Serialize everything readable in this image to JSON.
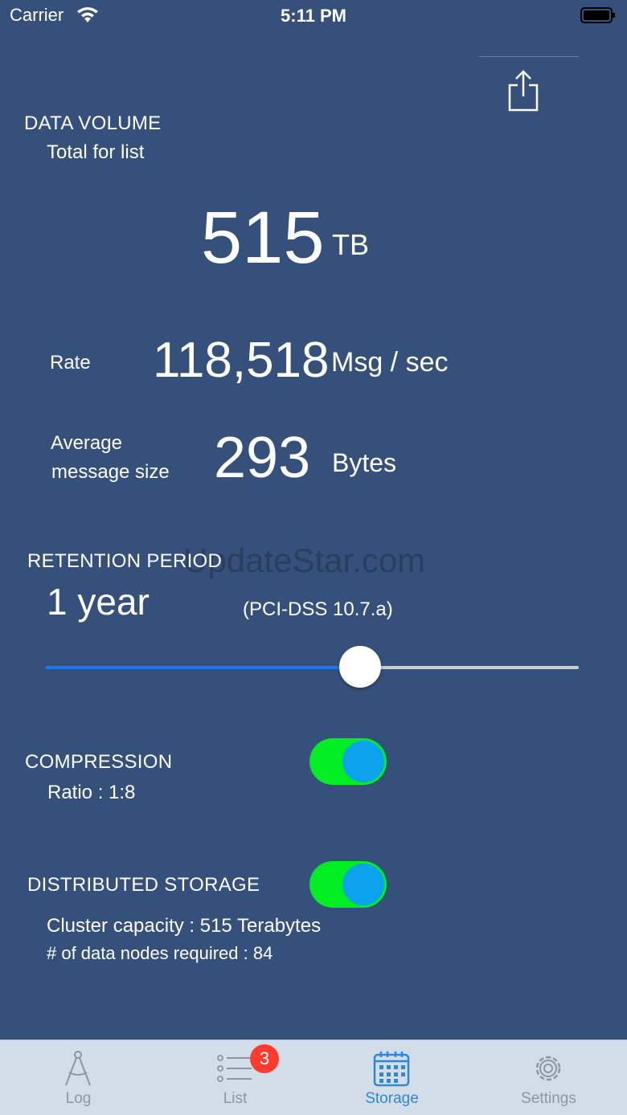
{
  "status_bar": {
    "carrier": "Carrier",
    "time": "5:11 PM"
  },
  "data_volume": {
    "title": "DATA VOLUME",
    "subtitle": "Total for list",
    "value": "515",
    "unit": "TB"
  },
  "rate": {
    "label": "Rate",
    "value": "118,518",
    "unit": "Msg / sec"
  },
  "avg_size": {
    "label_line1": "Average",
    "label_line2": "message size",
    "value": "293",
    "unit": "Bytes"
  },
  "watermark": "UpdateStar.com",
  "retention": {
    "title": "RETENTION PERIOD",
    "value": "1 year",
    "note": "(PCI-DSS 10.7.a)",
    "slider_fraction": 0.59
  },
  "compression": {
    "title": "COMPRESSION",
    "ratio": "Ratio :   1:8",
    "enabled": true
  },
  "distributed_storage": {
    "title": "DISTRIBUTED STORAGE",
    "capacity": "Cluster capacity : 515 Terabytes",
    "nodes": "# of data nodes required : 84",
    "enabled": true
  },
  "colors": {
    "background": "#35507a",
    "toggle_on": "#00ee22",
    "toggle_knob": "#0ca2ee",
    "slider_fill": "#1a7bf0",
    "tab_active": "#2f87d8",
    "badge": "#ff3b30"
  },
  "tabs": [
    {
      "label": "Log",
      "icon": "compass-icon",
      "active": false
    },
    {
      "label": "List",
      "icon": "list-icon",
      "active": false,
      "badge": "3"
    },
    {
      "label": "Storage",
      "icon": "calendar-icon",
      "active": true
    },
    {
      "label": "Settings",
      "icon": "gear-icon",
      "active": false
    }
  ]
}
